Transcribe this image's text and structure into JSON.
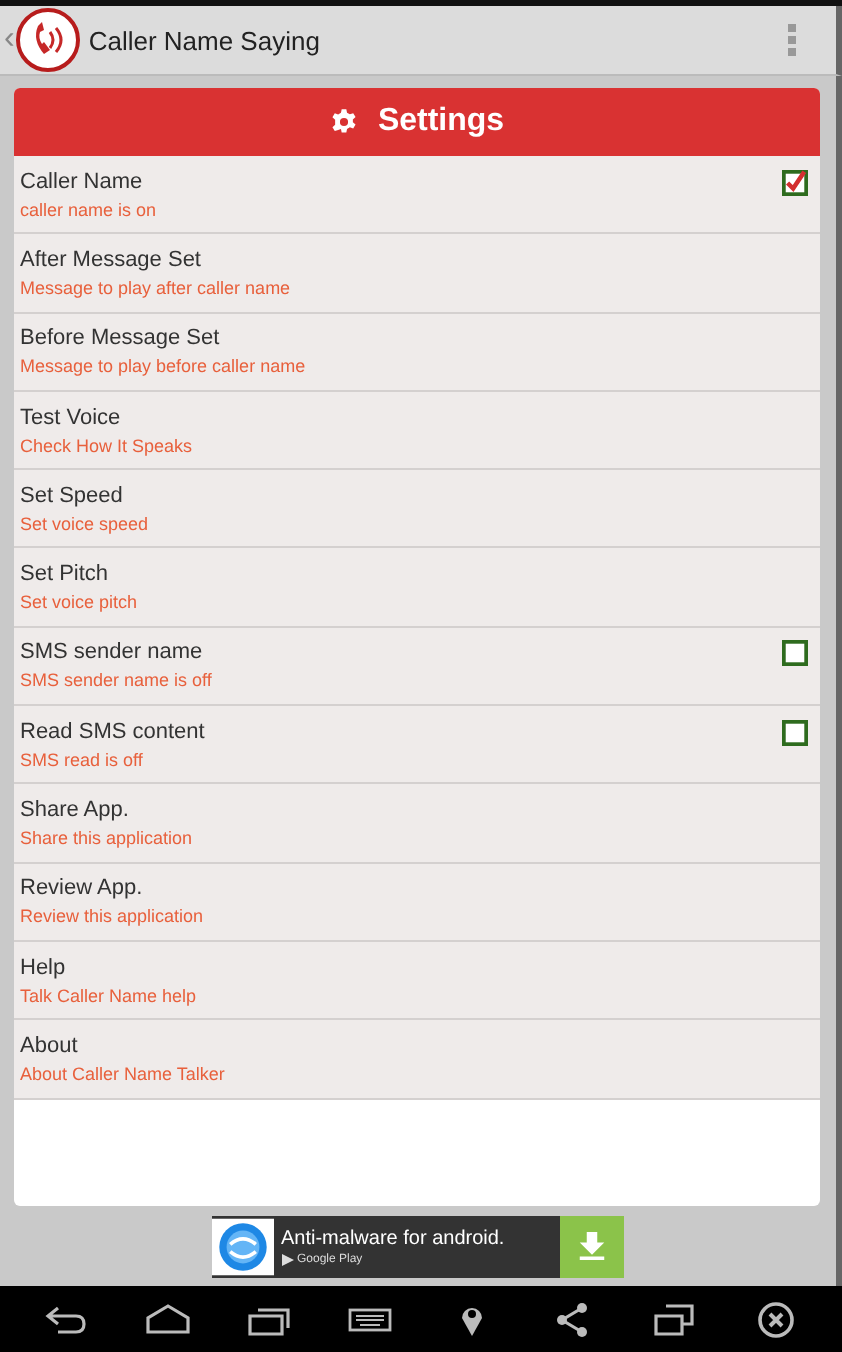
{
  "action_bar": {
    "title": "Caller Name Saying",
    "back": "‹"
  },
  "header": {
    "title": "Settings"
  },
  "settings": [
    {
      "kind": "checkbox",
      "title": "Caller Name",
      "summary": "caller name is on",
      "checked": true
    },
    {
      "kind": "plain",
      "title": "After Message Set",
      "summary": "Message to play after caller name"
    },
    {
      "kind": "plain",
      "title": "Before Message Set",
      "summary": "Message to play before caller name"
    },
    {
      "kind": "plain",
      "title": "Test Voice",
      "summary": "Check How It Speaks"
    },
    {
      "kind": "plain",
      "title": "Set Speed",
      "summary": "Set voice speed"
    },
    {
      "kind": "plain",
      "title": "Set Pitch",
      "summary": "Set voice pitch"
    },
    {
      "kind": "checkbox",
      "title": "SMS sender name",
      "summary": "SMS sender name is off",
      "checked": false
    },
    {
      "kind": "checkbox",
      "title": "Read SMS content",
      "summary": "SMS read is off",
      "checked": false
    },
    {
      "kind": "plain",
      "title": "Share App.",
      "summary": "Share this application"
    },
    {
      "kind": "plain",
      "title": "Review App.",
      "summary": "Review this application"
    },
    {
      "kind": "plain",
      "title": "Help",
      "summary": "Talk Caller Name help"
    },
    {
      "kind": "plain",
      "title": "About",
      "summary": "About Caller Name Talker"
    }
  ],
  "ad": {
    "text": "Anti-malware for android.",
    "store": "Google Play"
  }
}
